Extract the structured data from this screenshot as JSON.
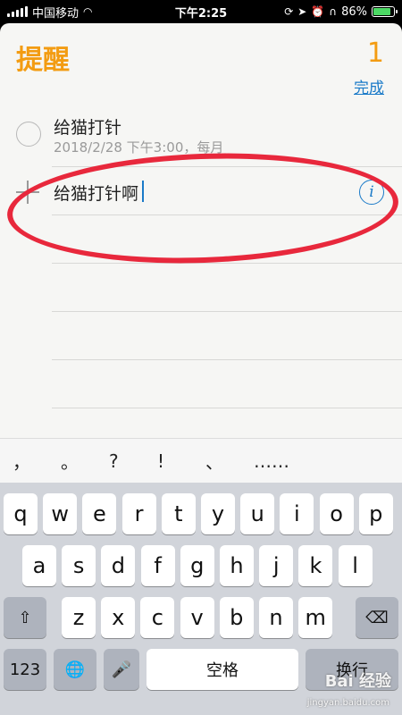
{
  "status_bar": {
    "carrier": "中国移动",
    "time": "下午2:25",
    "battery": "86%",
    "battery_level": 0.86
  },
  "app": {
    "title": "提醒",
    "count": "1",
    "done_label": "完成"
  },
  "reminder": {
    "title": "给猫打针",
    "subtitle": "2018/2/28 下午3:00，每月"
  },
  "new_item": {
    "value": "给猫打针啊"
  },
  "punctuation": [
    "，",
    "。",
    "?",
    "!",
    "、",
    "……"
  ],
  "keyboard": {
    "row1": [
      "q",
      "w",
      "e",
      "r",
      "t",
      "y",
      "u",
      "i",
      "o",
      "p"
    ],
    "row2": [
      "a",
      "s",
      "d",
      "f",
      "g",
      "h",
      "j",
      "k",
      "l"
    ],
    "row3": [
      "z",
      "x",
      "c",
      "v",
      "b",
      "n",
      "m"
    ],
    "num_label": "123",
    "space_label": "空格",
    "return_label": "换行"
  },
  "watermark": {
    "text": "Bai 经验",
    "sub": "jingyan.baidu.com"
  }
}
